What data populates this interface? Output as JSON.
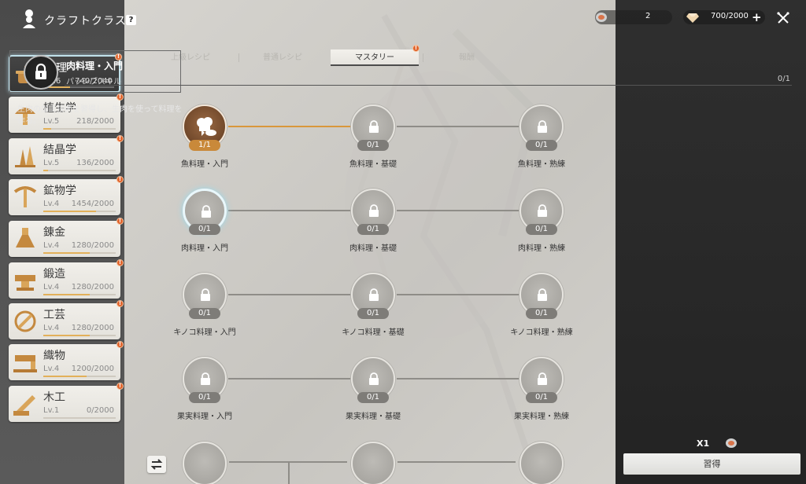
{
  "header": {
    "title": "クラフトクラス",
    "help_label": "?"
  },
  "top_bar": {
    "resource1_value": "2",
    "resource2_value": "700/2000",
    "plus_label": "+"
  },
  "categories": [
    {
      "name": "料理",
      "level": "Lv.6",
      "exp": "740/2040",
      "progress": 0.36,
      "icon": "cooking-pot-icon",
      "active": true
    },
    {
      "name": "植生学",
      "level": "Lv.5",
      "exp": "218/2000",
      "progress": 0.11,
      "icon": "mushroom-icon"
    },
    {
      "name": "結晶学",
      "level": "Lv.5",
      "exp": "136/2000",
      "progress": 0.07,
      "icon": "crystal-icon"
    },
    {
      "name": "鉱物学",
      "level": "Lv.4",
      "exp": "1454/2000",
      "progress": 0.73,
      "icon": "pickaxe-icon"
    },
    {
      "name": "錬金",
      "level": "Lv.4",
      "exp": "1280/2000",
      "progress": 0.64,
      "icon": "flask-icon"
    },
    {
      "name": "鍛造",
      "level": "Lv.4",
      "exp": "1280/2000",
      "progress": 0.64,
      "icon": "anvil-icon"
    },
    {
      "name": "工芸",
      "level": "Lv.4",
      "exp": "1280/2000",
      "progress": 0.64,
      "icon": "craft-tools-icon"
    },
    {
      "name": "織物",
      "level": "Lv.4",
      "exp": "1200/2000",
      "progress": 0.6,
      "icon": "sewing-machine-icon"
    },
    {
      "name": "木工",
      "level": "Lv.1",
      "exp": "0/2000",
      "progress": 0.0,
      "icon": "saw-icon"
    }
  ],
  "tabs": [
    {
      "label": "上級レシピ"
    },
    {
      "label": "普通レシピ"
    },
    {
      "label": "マスタリー",
      "active": true
    },
    {
      "label": "報酬"
    }
  ],
  "skill_tree": {
    "rows": [
      [
        {
          "name": "魚料理・入門",
          "count": "1/1",
          "state": "unlocked"
        },
        {
          "name": "魚料理・基礎",
          "count": "0/1",
          "state": "locked"
        },
        {
          "name": "魚料理・熟練",
          "count": "0/1",
          "state": "locked"
        }
      ],
      [
        {
          "name": "肉料理・入門",
          "count": "0/1",
          "state": "selected"
        },
        {
          "name": "肉料理・基礎",
          "count": "0/1",
          "state": "locked"
        },
        {
          "name": "肉料理・熟練",
          "count": "0/1",
          "state": "locked"
        }
      ],
      [
        {
          "name": "キノコ料理・入門",
          "count": "0/1",
          "state": "locked"
        },
        {
          "name": "キノコ料理・基礎",
          "count": "0/1",
          "state": "locked"
        },
        {
          "name": "キノコ料理・熟練",
          "count": "0/1",
          "state": "locked"
        }
      ],
      [
        {
          "name": "果実料理・入門",
          "count": "0/1",
          "state": "locked"
        },
        {
          "name": "果実料理・基礎",
          "count": "0/1",
          "state": "locked"
        },
        {
          "name": "果実料理・熟練",
          "count": "0/1",
          "state": "locked"
        }
      ]
    ]
  },
  "detail": {
    "name": "肉料理・入門",
    "type": "パッシブスキル",
    "level": "0/1",
    "description": "生肉の加工技術を習得し、生肉を使って料理を作る。",
    "cost_multiplier": "X1",
    "learn_label": "習得"
  },
  "colors": {
    "accent": "#d9973b",
    "alert": "#e0642d",
    "progress": "#e2b05a"
  }
}
